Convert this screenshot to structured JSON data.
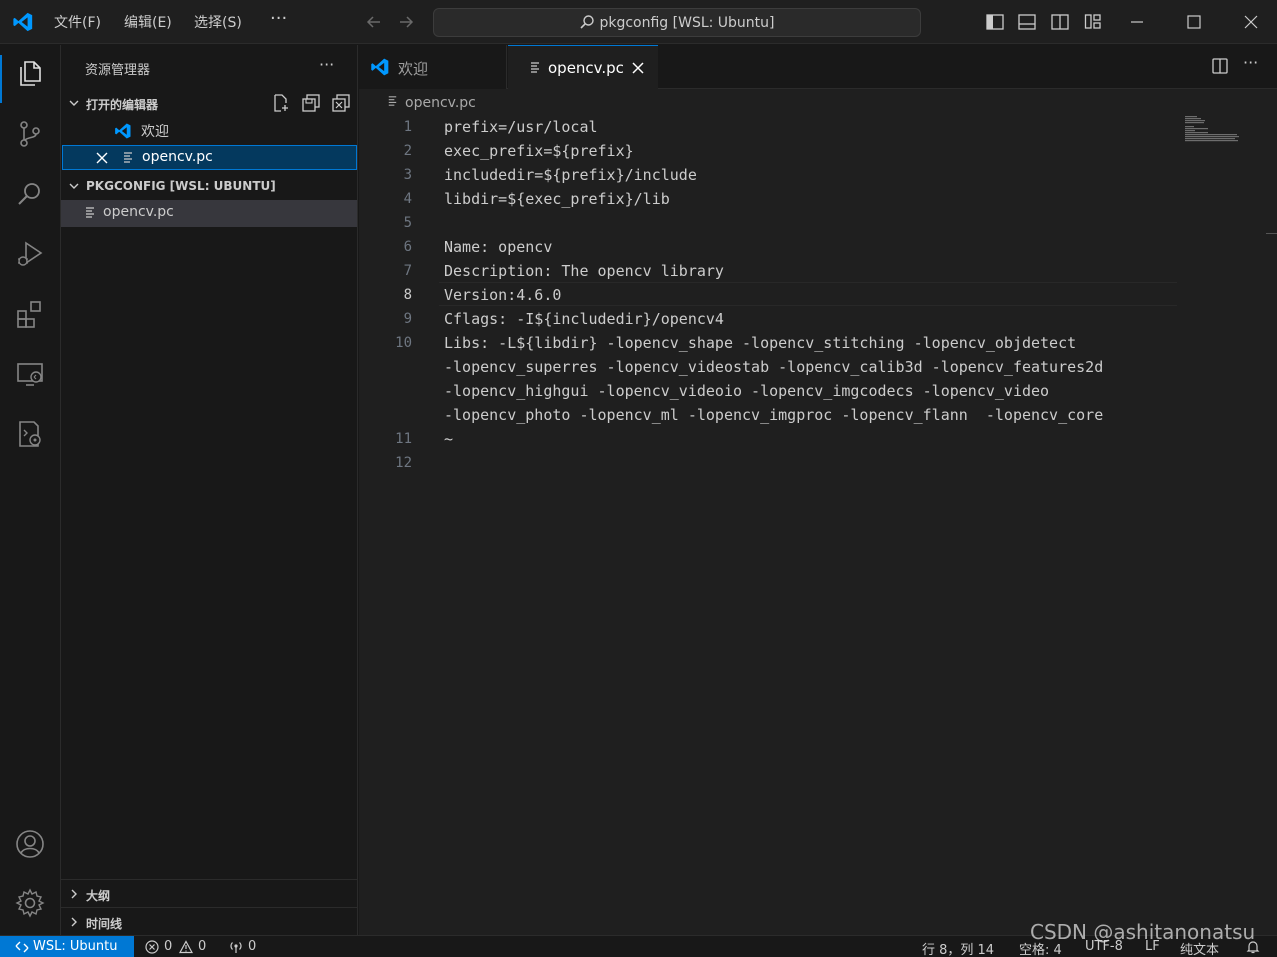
{
  "titlebar": {
    "menus": [
      "文件(F)",
      "编辑(E)",
      "选择(S)"
    ],
    "more": "···",
    "command_center": "pkgconfig [WSL: Ubuntu]"
  },
  "sidebar": {
    "title": "资源管理器",
    "more": "···",
    "open_editors_header": "打开的编辑器",
    "open_editors": [
      {
        "label": "欢迎"
      },
      {
        "label": "opencv.pc"
      }
    ],
    "workspace_header": "PKGCONFIG [WSL: UBUNTU]",
    "files": [
      {
        "label": "opencv.pc"
      }
    ],
    "outline_header": "大纲",
    "timeline_header": "时间线"
  },
  "tabs": [
    {
      "label": "欢迎"
    },
    {
      "label": "opencv.pc"
    }
  ],
  "editor": {
    "breadcrumb": "opencv.pc",
    "current_line": 8,
    "lines": [
      {
        "n": "1",
        "text": "prefix=/usr/local"
      },
      {
        "n": "2",
        "text": "exec_prefix=${prefix}"
      },
      {
        "n": "3",
        "text": "includedir=${prefix}/include"
      },
      {
        "n": "4",
        "text": "libdir=${exec_prefix}/lib"
      },
      {
        "n": "5",
        "text": ""
      },
      {
        "n": "6",
        "text": "Name: opencv"
      },
      {
        "n": "7",
        "text": "Description: The opencv library"
      },
      {
        "n": "8",
        "text": "Version:4.6.0"
      },
      {
        "n": "9",
        "text": "Cflags: -I${includedir}/opencv4"
      },
      {
        "n": "10",
        "text": "Libs: -L${libdir} -lopencv_shape -lopencv_stitching -lopencv_objdetect"
      },
      {
        "n": "",
        "text": "-lopencv_superres -lopencv_videostab -lopencv_calib3d -lopencv_features2d"
      },
      {
        "n": "",
        "text": "-lopencv_highgui -lopencv_videoio -lopencv_imgcodecs -lopencv_video"
      },
      {
        "n": "",
        "text": "-lopencv_photo -lopencv_ml -lopencv_imgproc -lopencv_flann  -lopencv_core"
      },
      {
        "n": "11",
        "text": "~"
      },
      {
        "n": "12",
        "text": ""
      }
    ]
  },
  "statusbar": {
    "remote": "WSL: Ubuntu",
    "errors": "0",
    "warnings": "0",
    "ports": "0",
    "cursor": "行 8，列 14",
    "indent": "空格: 4",
    "encoding": "UTF-8",
    "eol": "LF",
    "language": "纯文本"
  },
  "watermark": "CSDN @ashitanonatsu",
  "colors": {
    "accent": "#0078d4",
    "background": "#1f1f1f",
    "sidebar_bg": "#181818",
    "selection": "#04395e"
  },
  "icons": [
    "vscode-logo-icon",
    "search-icon",
    "explorer-icon",
    "source-control-icon",
    "run-debug-icon",
    "extensions-icon",
    "remote-explorer-icon",
    "test-icon",
    "account-icon",
    "gear-icon",
    "file-text-icon",
    "close-icon",
    "split-editor-icon",
    "bell-icon"
  ]
}
